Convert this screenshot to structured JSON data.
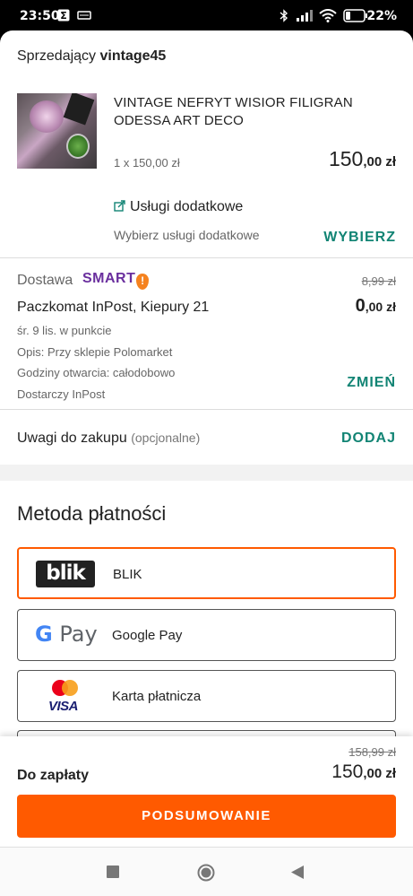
{
  "status_bar": {
    "time": "23:50",
    "battery_percent": "22%",
    "icons": [
      "app-notification-icon",
      "card-icon",
      "bluetooth-icon",
      "signal-icon",
      "wifi-icon",
      "battery-icon"
    ]
  },
  "seller": {
    "prefix": "Sprzedający",
    "name": "vintage45"
  },
  "product": {
    "name": "VINTAGE NEFRYT WISIOR FILIGRAN ODESSA ART DECO",
    "quantity_line": "1 x 150,00 zł",
    "price_int": "150",
    "price_dec": ",00 zł",
    "services_label": "Usługi dodatkowe",
    "services_sub": "Wybierz usługi dodatkowe",
    "services_action": "WYBIERZ"
  },
  "delivery": {
    "label": "Dostawa",
    "badge": "SMART",
    "badge_mark": "!",
    "old_price": "8,99 zł",
    "pickup_point": "Paczkomat InPost, Kiepury 21",
    "price_int": "0",
    "price_dec": ",00 zł",
    "eta": "śr. 9 lis. w punkcie",
    "description": "Opis: Przy sklepie Polomarket",
    "hours": "Godziny otwarcia: całodobowo",
    "carrier": "Dostarczy InPost",
    "change_action": "ZMIEŃ"
  },
  "notes": {
    "label": "Uwagi do zakupu",
    "optional": "(opcjonalne)",
    "action": "DODAJ"
  },
  "payment": {
    "title": "Metoda płatności",
    "options": [
      {
        "label": "BLIK",
        "logo": "blik",
        "selected": true
      },
      {
        "label": "Google Pay",
        "logo": "google-pay",
        "selected": false
      },
      {
        "label": "Karta płatnicza",
        "logo": "mastercard-visa",
        "selected": false
      }
    ],
    "blik_logo_text": "blik",
    "gpay_logo_g": "G",
    "gpay_logo_text": "Pay",
    "visa_text": "VISA"
  },
  "summary": {
    "old_total": "158,99 zł",
    "label": "Do zapłaty",
    "total_int": "150",
    "total_dec": ",00 zł",
    "cta": "PODSUMOWANIE"
  },
  "colors": {
    "accent": "#ff5a00",
    "link": "#128474",
    "smart_purple": "#6a2f9e"
  }
}
